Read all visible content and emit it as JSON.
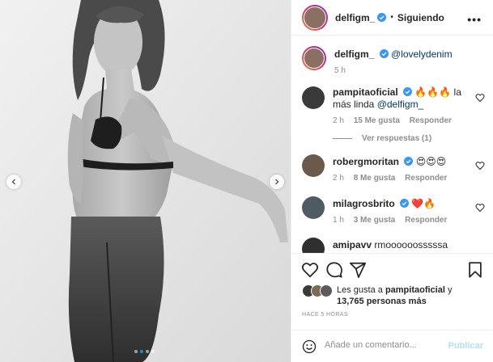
{
  "post": {
    "username": "delfigm_",
    "follow_separator": "•",
    "follow_status": "Siguiendo",
    "more_label": "•••",
    "caption_mention": "@lovelydenim",
    "caption_time": "5 h"
  },
  "comments": [
    {
      "username": "pampitaoficial",
      "text": "🔥🔥🔥 la más linda",
      "mention": "@delfigm_",
      "time": "2 h",
      "likes": "15 Me gusta",
      "reply": "Responder",
      "view_replies": "Ver respuestas (1)"
    },
    {
      "username": "robergmoritan",
      "text": "😍😍😍",
      "time": "2 h",
      "likes": "8 Me gusta",
      "reply": "Responder"
    },
    {
      "username": "milagrosbrito",
      "text": "❤️🔥",
      "time": "1 h",
      "likes": "3 Me gusta",
      "reply": "Responder"
    },
    {
      "username": "amipavv",
      "text": "rmoooooosssssa"
    }
  ],
  "likes": {
    "prefix": "Les gusta a",
    "user": "pampitaoficial",
    "joiner": "y",
    "count": "13,765 personas más"
  },
  "time_ago": "HACE 5 HORAS",
  "comment_input": {
    "placeholder": "Añade un comentario...",
    "publish": "Publicar"
  },
  "carousel": {
    "slides": 4,
    "active_index": 1
  },
  "colors": {
    "accent": "#0095f6",
    "verified": "#3897f0",
    "publish_disabled": "#b2dffc",
    "mention": "#00376b",
    "muted": "#8e8e8e"
  },
  "icons": [
    "heart-icon",
    "comment-icon",
    "share-icon",
    "bookmark-icon",
    "emoji-icon",
    "chevron-left-icon",
    "chevron-right-icon",
    "verified-badge-icon"
  ]
}
